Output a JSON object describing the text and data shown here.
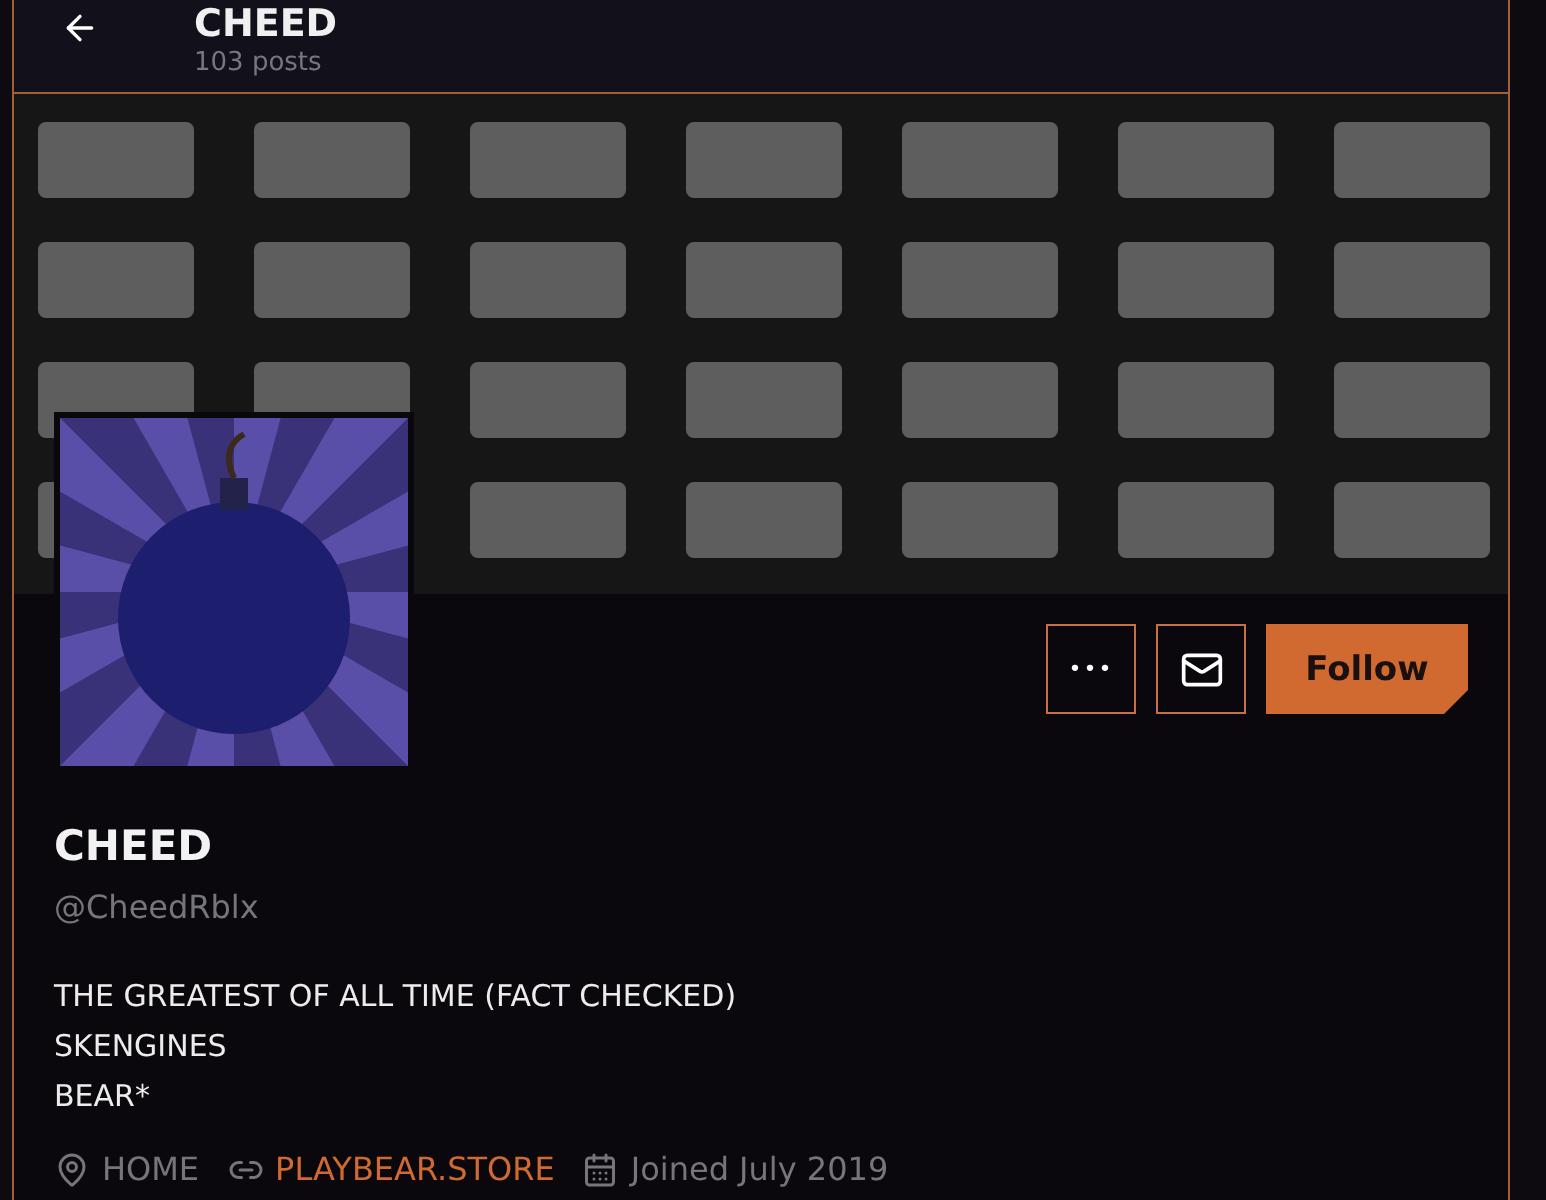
{
  "header": {
    "title": "CHEED",
    "subtitle": "103 posts"
  },
  "actions": [
    {
      "kind": "more",
      "label": "•••"
    },
    {
      "kind": "message"
    },
    {
      "kind": "follow",
      "label": "Follow"
    }
  ],
  "profile": {
    "name": "CHEED",
    "handle": "@CheedRblx",
    "bio": [
      "THE GREATEST OF ALL TIME (FACT CHECKED)",
      "SKENGINES",
      "BEAR*"
    ]
  },
  "meta": [
    {
      "kind": "location",
      "text": "HOME"
    },
    {
      "kind": "link",
      "text": "PLAYBEAR.STORE"
    },
    {
      "kind": "joined",
      "text": "Joined July 2019"
    }
  ]
}
